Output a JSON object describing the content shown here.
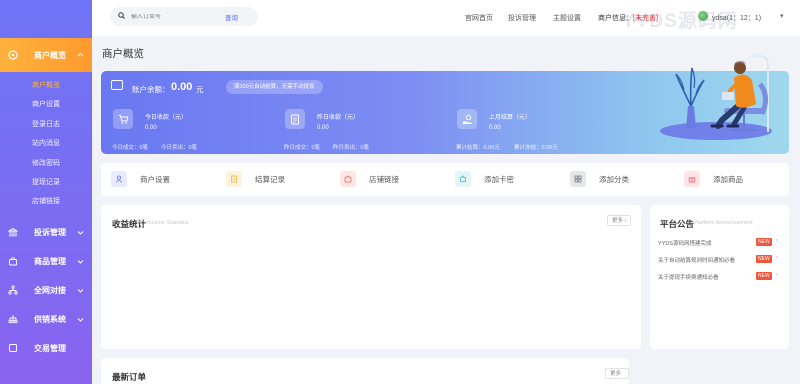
{
  "sidebar": {
    "active_menu": {
      "label": "商户概览",
      "icon": "home-icon"
    },
    "sub_items": [
      {
        "label": "商户概览",
        "active": true
      },
      {
        "label": "商户设置",
        "active": false
      },
      {
        "label": "登录日志",
        "active": false
      },
      {
        "label": "站内消息",
        "active": false
      },
      {
        "label": "修改密码",
        "active": false
      },
      {
        "label": "提现记录",
        "active": false
      },
      {
        "label": "店铺链接",
        "active": false
      }
    ],
    "menus": [
      {
        "label": "投诉管理",
        "icon": "bank-icon"
      },
      {
        "label": "商品管理",
        "icon": "bag-icon"
      },
      {
        "label": "全网对接",
        "icon": "network-icon"
      },
      {
        "label": "供销系统",
        "icon": "supply-icon"
      },
      {
        "label": "交易管理",
        "icon": "trade-icon"
      }
    ]
  },
  "header": {
    "search_placeholder": "输入订单号",
    "search_button": "查询",
    "nav": [
      "官网首页",
      "投诉管理",
      "主题设置"
    ],
    "account_label": "商户信息：",
    "account_status": "[未完善]",
    "username": "ydsa(1：12：1)",
    "watermark": "YYDS源码网"
  },
  "page_title": "商户概览",
  "banner": {
    "balance_label": "账户余额：",
    "balance_value": "0.00",
    "balance_unit": "元",
    "promo": "满100元自动结算，无需手动提现",
    "stats": [
      {
        "label": "今日收款（元）",
        "value": "0.00",
        "icon": "cart-icon",
        "sub": [
          "今日成交：0笔",
          "今日卖出：0笔"
        ]
      },
      {
        "label": "昨日收款（元）",
        "value": "0.00",
        "icon": "document-icon",
        "sub": [
          "昨日成交：0笔",
          "昨日卖出：0笔"
        ]
      },
      {
        "label": "上月结算（元）",
        "value": "0.00",
        "icon": "coin-hand-icon",
        "sub": [
          "累计结算：0.00元",
          "累计冻结：0.00元"
        ]
      }
    ]
  },
  "shortcuts": [
    {
      "label": "商户设置",
      "icon": "user-icon",
      "bg": "#e8ebfd",
      "fg": "#6c78ee"
    },
    {
      "label": "结算记录",
      "icon": "file-icon",
      "bg": "#fdf3dc",
      "fg": "#f3b23a"
    },
    {
      "label": "店铺链接",
      "icon": "shop-icon",
      "bg": "#fde6e3",
      "fg": "#ee6a5c"
    },
    {
      "label": "添加卡密",
      "icon": "puzzle-icon",
      "bg": "#e2f5f8",
      "fg": "#45b8cc"
    },
    {
      "label": "添加分类",
      "icon": "grid-icon",
      "bg": "#e5e6e9",
      "fg": "#6b6f7a"
    },
    {
      "label": "添加商品",
      "icon": "gift-icon",
      "bg": "#fde4e6",
      "fg": "#ef5b68"
    }
  ],
  "income": {
    "title": "收益统计",
    "subtitle": "Income Statistics",
    "more": "更多 ›"
  },
  "notice": {
    "title": "平台公告",
    "subtitle": "Platform Announcement",
    "items": [
      {
        "text": "YYDS源码网搭建完成",
        "badge": "NEW"
      },
      {
        "text": "关于自动结算规则时间通知必看",
        "badge": "NEW"
      },
      {
        "text": "关于提现手续费通知必看",
        "badge": "NEW"
      }
    ]
  },
  "orders": {
    "title": "最新订单",
    "more": "更多 ›"
  }
}
